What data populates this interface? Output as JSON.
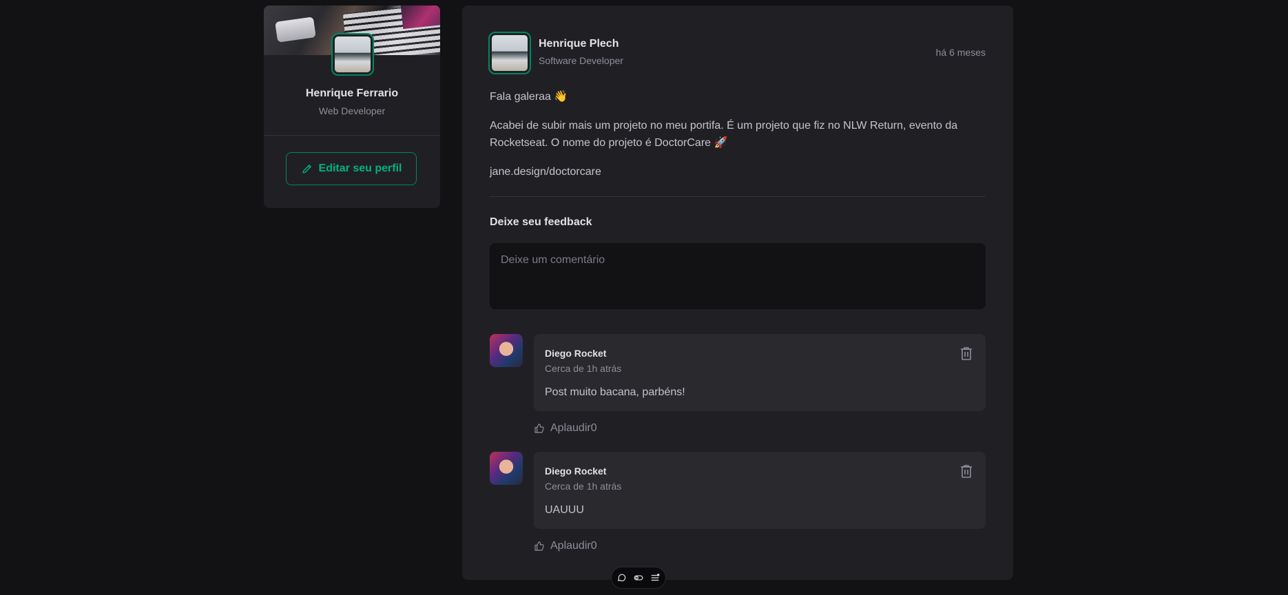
{
  "sidebar": {
    "name": "Henrique Ferrario",
    "role": "Web Developer",
    "edit_button": "Editar seu perfil"
  },
  "post": {
    "author": {
      "name": "Henrique Plech",
      "role": "Software Developer"
    },
    "time": "há 6 meses",
    "content": [
      "Fala galeraa 👋",
      "Acabei de subir mais um projeto no meu portifa. É um projeto que fiz no NLW Return, evento da Rocketseat. O nome do projeto é DoctorCare 🚀",
      "jane.design/doctorcare"
    ],
    "feedback_title": "Deixe seu feedback",
    "comment_placeholder": "Deixe um comentário"
  },
  "comments": [
    {
      "author": "Diego Rocket",
      "time": "Cerca de 1h atrás",
      "text": "Post muito bacana, parbéns!",
      "applaud": "Aplaudir0"
    },
    {
      "author": "Diego Rocket",
      "time": "Cerca de 1h atrás",
      "text": "UAUUU",
      "applaud": "Aplaudir0"
    }
  ],
  "colors": {
    "background": "#121214",
    "card": "#202024",
    "accent": "#00875f",
    "accent_text": "#00b37e",
    "comment_bg": "#29292e"
  },
  "icons": {
    "edit": "pencil-icon",
    "delete": "trash-icon",
    "applaud": "thumbs-up-icon",
    "toolbar": [
      "chat-icon",
      "toggle-icon",
      "list-icon"
    ]
  }
}
